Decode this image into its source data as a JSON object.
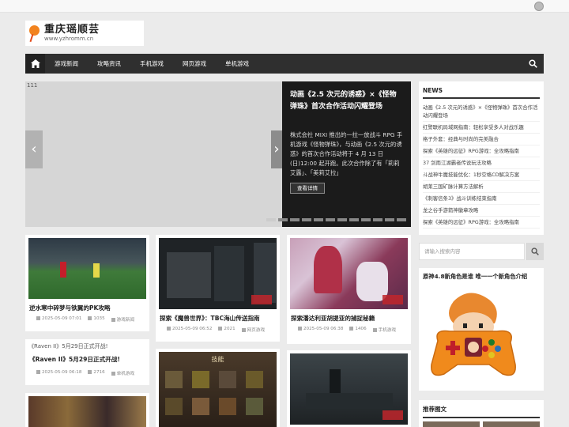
{
  "site": {
    "title": "重庆瑶顺芸",
    "domain": "www.yzhromm.cn"
  },
  "nav": {
    "items": [
      "游戏新闻",
      "攻略资讯",
      "手机游戏",
      "网页游戏",
      "单机游戏"
    ]
  },
  "slider": {
    "image_alt": "111",
    "title": "动画《2.5 次元的诱惑》×《怪物弹珠》首次合作活动闪耀登场",
    "description": "株式会社 MIXI 推出的一拉一放战斗 RPG 手机游戏《怪物弹珠》，与动画《2.5 次元的诱惑》的首次合作活动将于 4 月 13 日(日)12:00 起开跑。此次合作除了有「莉莉艾露」、「美莉艾拉」",
    "button": "查看详情",
    "prev": "‹",
    "next": "›",
    "dot_count": 12,
    "active_dot": 0
  },
  "news": {
    "heading": "NEWS",
    "items": [
      "动画《2.5 次元的诱惑》×《怪物弹珠》首次合作活动闪耀登场",
      "红警联机局域网指南：轻松享受多人对战乐趣",
      "格子外套：经典与时尚的完美融合",
      "探索《英雄的远征》RPG游戏：全攻略指南",
      "37 剑雨江湖霸者传说玩法攻略",
      "斗战神牛魔技能优化：1秒空格CD解决方案",
      "胡莱三国矿脉计算方法解析",
      "《刺客信条3》战斗训练结束指南",
      "龙之谷手游箭神徽章攻略",
      "探索《英雄的远征》RPG游戏：全攻略指南"
    ]
  },
  "search": {
    "placeholder": "请输入搜索内容"
  },
  "promo": {
    "title": "原神4.8新角色是谁 唯一一个新角色介绍"
  },
  "recommend": {
    "heading": "推荐图文"
  },
  "cards": [
    {
      "title": "逆水寒中碎梦与铁翼的PK攻略",
      "date": "2025-05-09 07:01",
      "views": "1035",
      "category": "游戏新闻"
    },
    {
      "title": "《Raven II》5月29日正式开战!",
      "image_alt": "《Raven II》5月29日正式开战!",
      "date": "2025-05-09 06:18",
      "views": "2716",
      "category": "单机游戏"
    },
    {
      "title": "探索《魔兽世界》：TBC海山传送指南",
      "date": "2025-05-09 06:52",
      "views": "2021",
      "category": "网页游戏"
    },
    {
      "title": "探索潘达利亚胡提亚的捕捉秘籍",
      "date": "2025-05-09 06:38",
      "views": "1406",
      "category": "手机游戏"
    },
    {
      "title": "",
      "image_label": "技能"
    }
  ],
  "colors": {
    "nav_bg": "#2f2f2f",
    "page_bg": "#ebebeb",
    "slider_panel": "#1b1b1b",
    "logo_orange": "#f2831f"
  }
}
